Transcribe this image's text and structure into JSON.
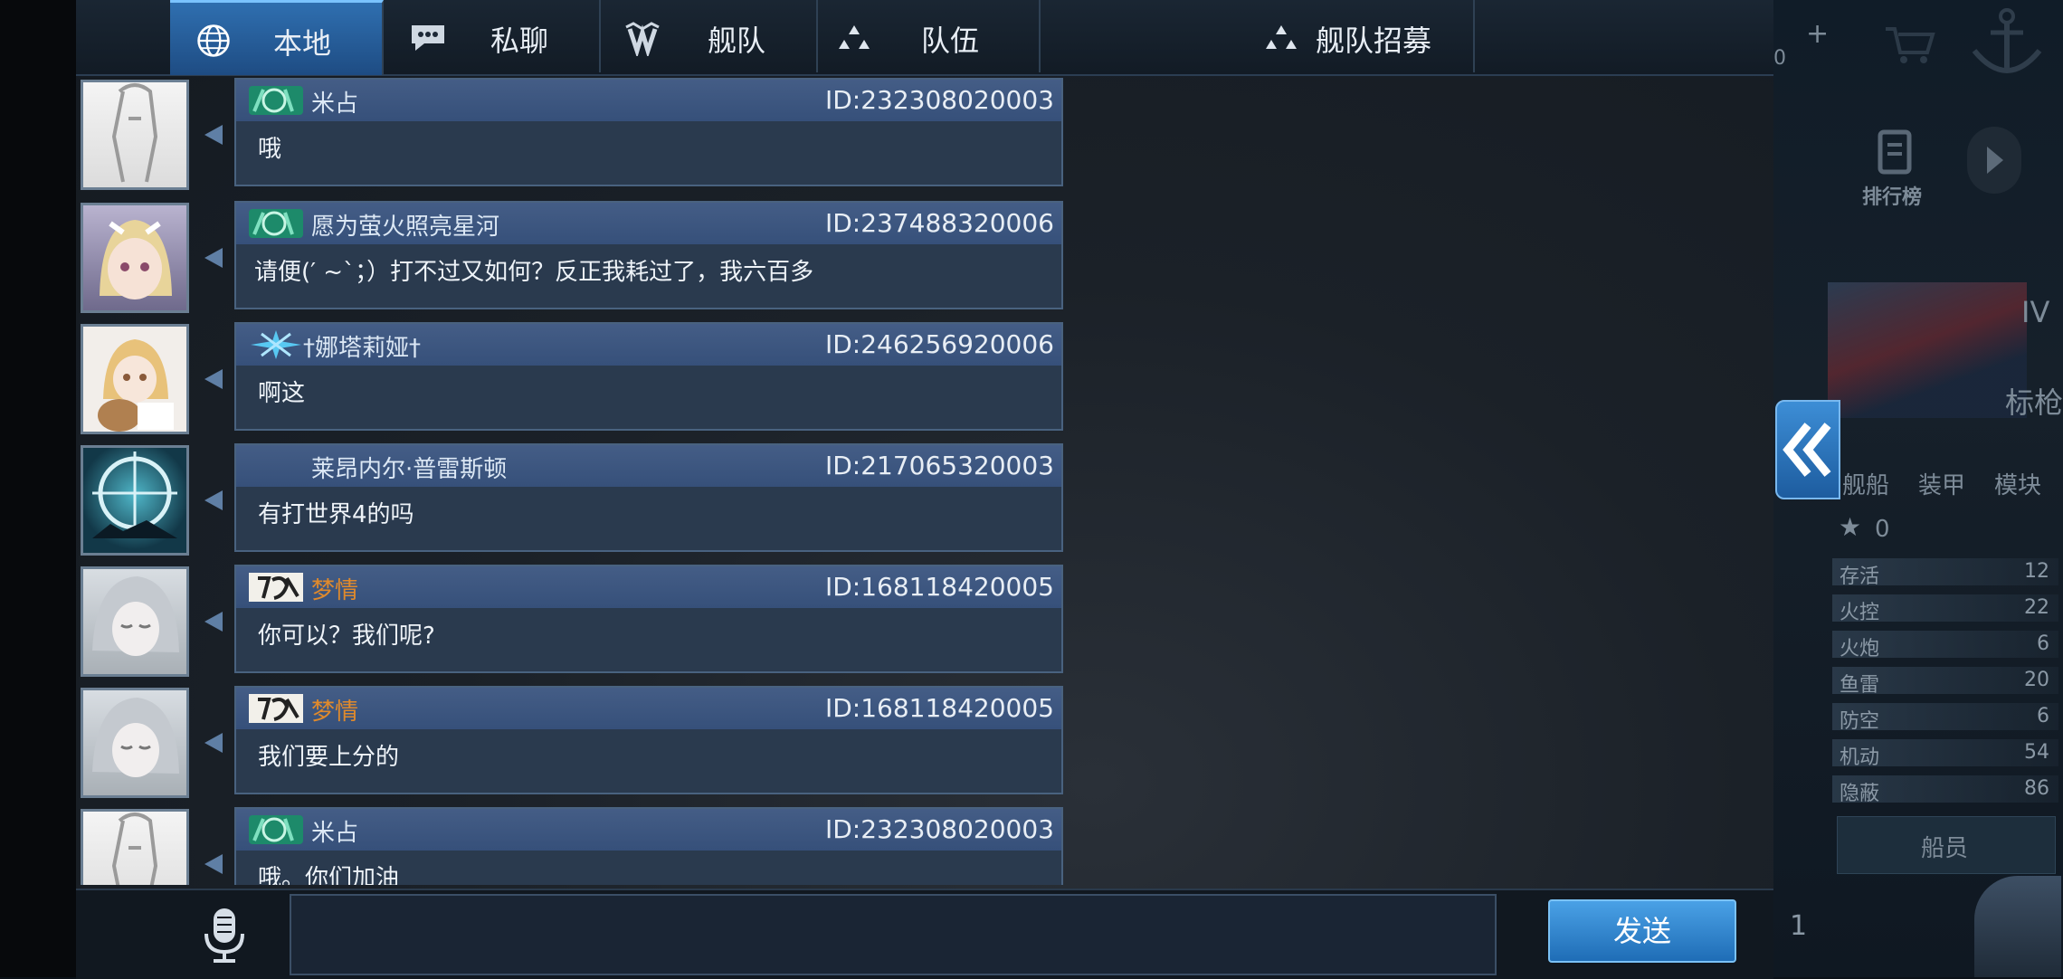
{
  "tabs": [
    {
      "label": "本地",
      "icon": "globe-icon",
      "active": true
    },
    {
      "label": "私聊",
      "icon": "chat-bubble-icon",
      "active": false
    },
    {
      "label": "舰队",
      "icon": "fleet-icon",
      "active": false
    },
    {
      "label": "队伍",
      "icon": "team-icon",
      "active": false
    },
    {
      "label": "舰队招募",
      "icon": "team-icon",
      "active": false
    }
  ],
  "messages": [
    {
      "name": "米占",
      "id": "ID:232308020003",
      "text": "哦",
      "badge": "green-emblem",
      "avatar": "sketch-girl",
      "name_color": "default"
    },
    {
      "name": "愿为萤火照亮星河",
      "id": "ID:237488320006",
      "text": "请便(′ ~`；）打不过又如何？反正我耗过了，我六百多",
      "badge": "green-emblem",
      "avatar": "blonde-girl",
      "name_color": "default"
    },
    {
      "name": "†娜塔莉娅†",
      "id": "ID:246256920006",
      "text": "啊这",
      "badge": "blue-star-emblem",
      "avatar": "bear-girl",
      "name_color": "default"
    },
    {
      "name": "莱昂内尔·普雷斯顿",
      "id": "ID:217065320003",
      "text": "有打世界4的吗",
      "badge": "none",
      "avatar": "ship-radar",
      "name_color": "default"
    },
    {
      "name": "梦情",
      "id": "ID:168118420005",
      "text": "你可以？我们呢?",
      "badge": "calligraphy-emblem",
      "avatar": "silver-hair-girl",
      "name_color": "orange"
    },
    {
      "name": "梦情",
      "id": "ID:168118420005",
      "text": "我们要上分的",
      "badge": "calligraphy-emblem",
      "avatar": "silver-hair-girl",
      "name_color": "orange"
    },
    {
      "name": "米占",
      "id": "ID:232308020003",
      "text": "哦。你们加油",
      "badge": "green-emblem",
      "avatar": "sketch-girl",
      "name_color": "default"
    }
  ],
  "input": {
    "placeholder": "",
    "value": ""
  },
  "send_label": "发送",
  "background_ui": {
    "stats": [
      {
        "label": "存活",
        "value": "12"
      },
      {
        "label": "火控",
        "value": "22"
      },
      {
        "label": "火炮",
        "value": "6"
      },
      {
        "label": "鱼雷",
        "value": "20"
      },
      {
        "label": "防空",
        "value": "6"
      },
      {
        "label": "机动",
        "value": "54"
      },
      {
        "label": "隐蔽",
        "value": "86"
      }
    ],
    "star_count": "0",
    "rank": "IV",
    "ship_type": "标枪",
    "ranking_label": "排行榜",
    "tab_labels": [
      "舰船",
      "装甲",
      "模块"
    ],
    "crew_label": "船员",
    "slot_number": "1",
    "top_count": "0"
  },
  "colors": {
    "accent": "#2f6fb0",
    "send_button": "#3a8ad6",
    "orange_name": "#e08a2c",
    "bubble_header": "#3f5883"
  }
}
